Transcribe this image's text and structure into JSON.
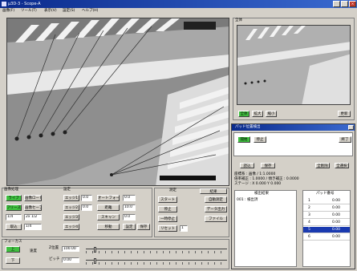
{
  "window": {
    "title": "μ3D-3 - Scope-A",
    "controls": [
      "_",
      "□",
      "×"
    ]
  },
  "menu": [
    "画像(F)",
    "ツール(T)",
    "表示(V)",
    "設定(S)",
    "ヘルプ(H)"
  ],
  "preview": {
    "title": "全体",
    "buttons": [
      "全体",
      "拡大",
      "縮小"
    ],
    "extra_button": "更新"
  },
  "dialog": {
    "title": "パッド位置検出",
    "top_buttons": [
      "開始",
      "停止"
    ],
    "top_right_button": "終了",
    "row_buttons": [
      "読込",
      "保存",
      "全削除",
      "全選択"
    ],
    "info": [
      "座標系 : 画像 / 1:1.0000",
      "倍率補正 : 1.0000 / 傾き補正 : 0.0000",
      "ステージ : X 0.000 Y 0.000"
    ],
    "list_header": "検出結果",
    "list_items": [
      "001 : 検出済"
    ],
    "grid_header": "パッド番号",
    "grid_rows": [
      [
        "1",
        "0.00"
      ],
      [
        "2",
        "0.00"
      ],
      [
        "3",
        "0.00"
      ],
      [
        "4",
        "0.00"
      ],
      [
        "5",
        "0.00"
      ],
      [
        "6",
        "0.00"
      ]
    ]
  },
  "control_panel": {
    "tab_label": "画像処理",
    "left_buttons": [
      [
        "ライブ",
        "画像ロード"
      ],
      [
        "フリーズ",
        "画像セーブ"
      ],
      [
        "1/4",
        "2x 1/2"
      ],
      [
        "取込",
        "1/4"
      ]
    ],
    "mid_label": "設定",
    "mid_buttons": [
      "エッジ1",
      "エッジ2",
      "エッジ3",
      "エッジ4"
    ],
    "mid_fields": [
      "0.0",
      "0.0"
    ],
    "right_buttons": [
      "オートフォーカス",
      "距離",
      "スキャン",
      "移動"
    ],
    "right_fields": [
      "0.0",
      "10.0",
      "0.0"
    ],
    "mini_buttons": [
      "設定",
      "保存"
    ]
  },
  "center_panel": {
    "header_left": "測定",
    "header_right": "結果",
    "buttons": [
      "スタート",
      "停止",
      "一時停止",
      "リセット"
    ],
    "right_buttons": [
      "自動測定",
      "データ出力",
      "ファイル"
    ],
    "field": "1"
  },
  "bottom_bar": {
    "label": "フォーカス",
    "buttons": [
      "上",
      "下"
    ],
    "mode_label": "速度",
    "fields": [
      "100.00",
      "0.00"
    ],
    "field_labels": [
      "Z位置",
      "ピッチ"
    ]
  },
  "colors": {
    "accent_green": "#3fbf3f",
    "titlebar": "#0a2a8c",
    "face": "#d4d0c8"
  }
}
